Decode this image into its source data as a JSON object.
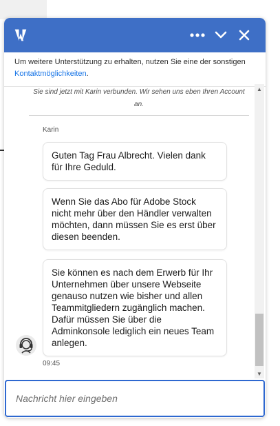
{
  "header": {
    "logo": "adobe-logo",
    "more_icon": "ellipsis-icon",
    "minimize_icon": "chevron-down-icon",
    "close_icon": "close-icon",
    "bg_color": "#3e6fc6"
  },
  "notice": {
    "text": "Um weitere Unterstützung zu erhalten, nutzen Sie eine der sonstigen",
    "link": "Kontaktmöglichkeiten",
    "suffix": "."
  },
  "conversation": {
    "system_message": "Sie sind jetzt mit Karin verbunden. Wir sehen uns eben Ihren Account an.",
    "agent_name": "Karin",
    "messages": [
      "Guten Tag Frau Albrecht. Vielen dank für Ihre Geduld.",
      "Wenn Sie das Abo für Adobe Stock nicht mehr über den Händler verwalten möchten, dann müssen Sie es erst über diesen beenden.",
      "Sie können es nach dem Erwerb für Ihr Unternehmen über unsere Webseite genauso nutzen wie bisher und allen Teammitgliedern zugänglich machen. Dafür müssen Sie über die Adminkonsole lediglich ein neues Team anlegen."
    ],
    "timestamp": "09:45",
    "avatar_icon": "headset-agent-icon"
  },
  "input": {
    "placeholder": "Nachricht hier eingeben",
    "value": ""
  }
}
